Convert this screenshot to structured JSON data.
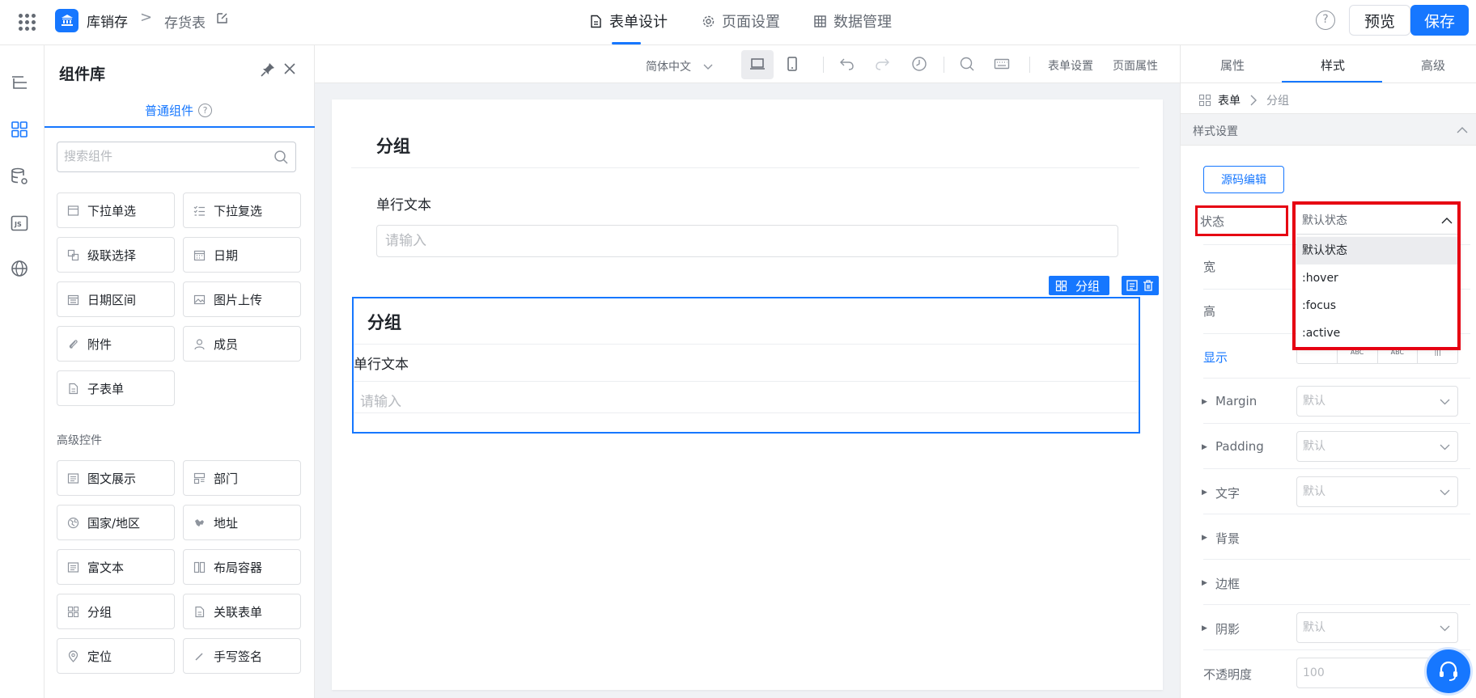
{
  "header": {
    "app_logo_icon": "bank-icon",
    "app_name": "库销存",
    "breadcrumb_sep": ">",
    "page_name": "存货表",
    "tabs": [
      {
        "label": "表单设计",
        "icon": "document-icon"
      },
      {
        "label": "页面设置",
        "icon": "gear-icon"
      },
      {
        "label": "数据管理",
        "icon": "table-icon"
      }
    ],
    "help": "?",
    "preview_label": "预览",
    "save_label": "保存"
  },
  "library": {
    "title": "组件库",
    "tab_label": "普通组件",
    "tab_help": "?",
    "search_placeholder": "搜索组件",
    "basic_items": [
      {
        "label": "下拉单选",
        "icon": "dropdown-icon"
      },
      {
        "label": "下拉复选",
        "icon": "checklist-icon"
      },
      {
        "label": "级联选择",
        "icon": "cascade-icon"
      },
      {
        "label": "日期",
        "icon": "calendar-icon"
      },
      {
        "label": "日期区间",
        "icon": "calendar-range-icon"
      },
      {
        "label": "图片上传",
        "icon": "image-icon"
      },
      {
        "label": "附件",
        "icon": "paperclip-icon"
      },
      {
        "label": "成员",
        "icon": "user-icon"
      },
      {
        "label": "子表单",
        "icon": "subform-icon"
      }
    ],
    "advanced_label": "高级控件",
    "advanced_items": [
      {
        "label": "图文展示",
        "icon": "richtext-icon"
      },
      {
        "label": "部门",
        "icon": "org-icon"
      },
      {
        "label": "国家/地区",
        "icon": "globe-icon"
      },
      {
        "label": "地址",
        "icon": "map-icon"
      },
      {
        "label": "富文本",
        "icon": "richtext-icon"
      },
      {
        "label": "布局容器",
        "icon": "layout-icon"
      },
      {
        "label": "分组",
        "icon": "group-icon"
      },
      {
        "label": "关联表单",
        "icon": "link-form-icon"
      },
      {
        "label": "定位",
        "icon": "location-icon"
      },
      {
        "label": "手写签名",
        "icon": "pen-icon"
      }
    ]
  },
  "toolbar": {
    "language": "简体中文",
    "form_settings": "表单设置",
    "page_props": "页面属性"
  },
  "canvas": {
    "group1_title": "分组",
    "field1_label": "单行文本",
    "field1_placeholder": "请输入",
    "selected_tag": "分组",
    "group2_title": "分组",
    "field2_label": "单行文本",
    "field2_placeholder": "请输入"
  },
  "props": {
    "tabs": [
      "属性",
      "样式",
      "高级"
    ],
    "active_tab": "样式",
    "crumb_root": "表单",
    "crumb_current": "分组",
    "section_title": "样式设置",
    "source_edit": "源码编辑",
    "state_label": "状态",
    "state_value": "默认状态",
    "state_options": [
      "默认状态",
      ":hover",
      ":focus",
      ":active"
    ],
    "width_label": "宽",
    "height_label": "高",
    "display_label": "显示",
    "display_options": [
      "",
      "ABC",
      "ABC",
      "|||"
    ],
    "margin_label": "Margin",
    "padding_label": "Padding",
    "text_label": "文字",
    "bg_label": "背景",
    "border_label": "边框",
    "shadow_label": "阴影",
    "opacity_label": "不透明度",
    "default_placeholder": "默认",
    "opacity_placeholder": "100"
  },
  "colors": {
    "accent": "#1677ff",
    "highlight": "#e60012"
  }
}
